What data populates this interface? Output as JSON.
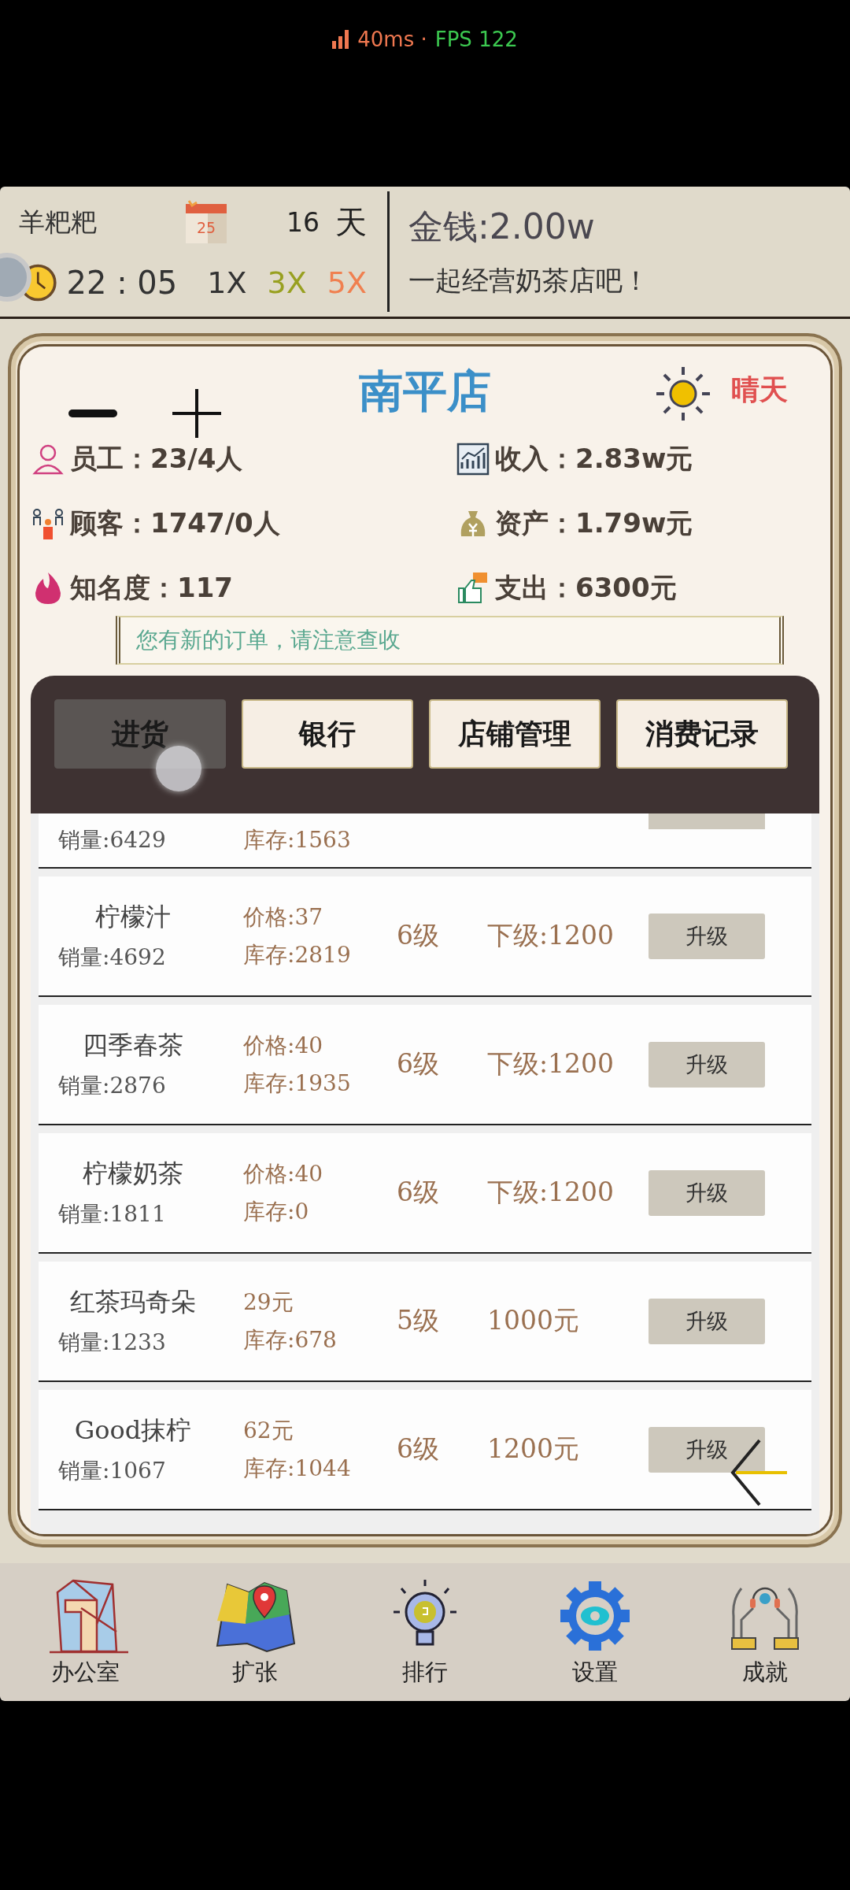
{
  "status_overlay": {
    "latency": "40ms ·",
    "fps": "FPS 122"
  },
  "header": {
    "player": "羊粑粑",
    "calendar_day": "25",
    "day": "16",
    "day_unit": "天",
    "time": "22 : 05",
    "speeds": [
      {
        "label": "1X",
        "color": "#333333"
      },
      {
        "label": "3X",
        "color": "#98a020"
      },
      {
        "label": "5X",
        "color": "#f08050"
      }
    ],
    "money": "金钱:2.00w",
    "slogan": "一起经营奶茶店吧！"
  },
  "store": {
    "name": "南平店",
    "weather": "晴天",
    "stats": [
      {
        "kind": "person",
        "text": "员工：23/4人"
      },
      {
        "kind": "chart",
        "text": "收入：2.83w元"
      },
      {
        "kind": "people",
        "text": "顾客：1747/0人"
      },
      {
        "kind": "moneybag",
        "text": "资产：1.79w元"
      },
      {
        "kind": "flame",
        "text": "知名度：117"
      },
      {
        "kind": "thumb",
        "text": "支出：6300元"
      }
    ],
    "notice": "您有新的订单，请注意查收"
  },
  "tabs": [
    {
      "label": "进货",
      "selected": true
    },
    {
      "label": "银行",
      "selected": false
    },
    {
      "label": "店铺管理",
      "selected": false
    },
    {
      "label": "消费记录",
      "selected": false
    }
  ],
  "products": [
    {
      "kind": "partial",
      "sales": "销量:6429",
      "stock": "库存:1563"
    },
    {
      "kind": "full",
      "name": "柠檬汁",
      "price": "价格:37",
      "sales": "销量:4692",
      "stock": "库存:2819",
      "grade": "6级",
      "cost": "下级:1200",
      "action": "升级"
    },
    {
      "kind": "full",
      "name": "四季春茶",
      "price": "价格:40",
      "sales": "销量:2876",
      "stock": "库存:1935",
      "grade": "6级",
      "cost": "下级:1200",
      "action": "升级"
    },
    {
      "kind": "full",
      "name": "柠檬奶茶",
      "price": "价格:40",
      "sales": "销量:1811",
      "stock": "库存:0",
      "grade": "6级",
      "cost": "下级:1200",
      "action": "升级"
    },
    {
      "kind": "full",
      "name": "红茶玛奇朵",
      "price": "29元",
      "sales": "销量:1233",
      "stock": "库存:678",
      "grade": "5级",
      "cost": "1000元",
      "action": "升级"
    },
    {
      "kind": "full",
      "name": "Good抹柠",
      "price": "62元",
      "sales": "销量:1067",
      "stock": "库存:1044",
      "grade": "6级",
      "cost": "1200元",
      "action": "升级"
    }
  ],
  "nav": [
    {
      "kind": "office",
      "label": "办公室"
    },
    {
      "kind": "map",
      "label": "扩张"
    },
    {
      "kind": "bulb",
      "label": "排行"
    },
    {
      "kind": "gear",
      "label": "设置"
    },
    {
      "kind": "hands",
      "label": "成就"
    }
  ]
}
